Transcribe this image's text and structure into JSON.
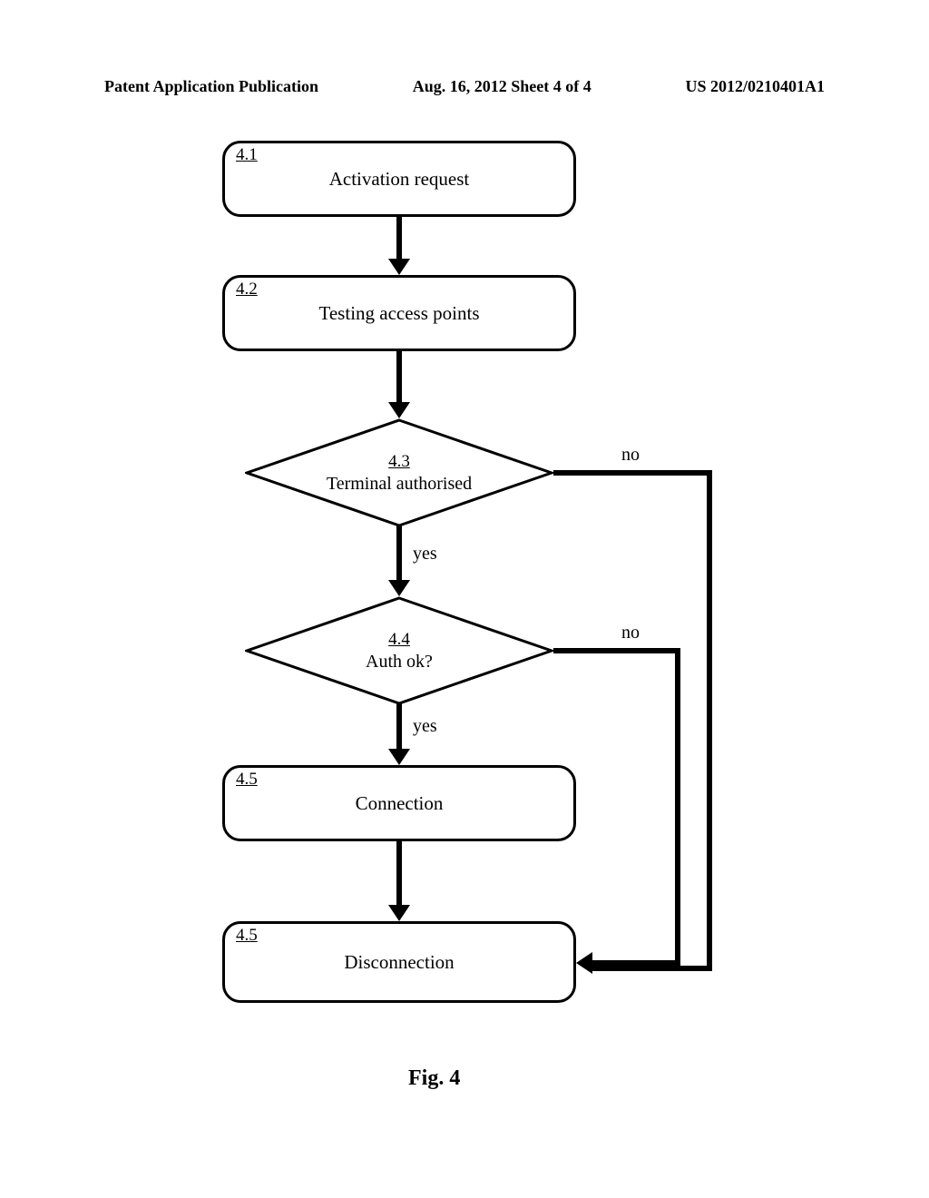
{
  "header": {
    "left": "Patent Application Publication",
    "center": "Aug. 16, 2012 Sheet 4 of 4",
    "right": "US 2012/0210401A1"
  },
  "flowchart": {
    "steps": {
      "s41": {
        "num": "4.1",
        "label": "Activation request"
      },
      "s42": {
        "num": "4.2",
        "label": "Testing access points"
      },
      "s43": {
        "num": "4.3",
        "label": "Terminal authorised"
      },
      "s44": {
        "num": "4.4",
        "label": "Auth ok?"
      },
      "s45": {
        "num": "4.5",
        "label": "Connection"
      },
      "s46": {
        "num": "4.5",
        "label": "Disconnection"
      }
    },
    "edges": {
      "yes43": "yes",
      "no43": "no",
      "yes44": "yes",
      "no44": "no"
    }
  },
  "caption": "Fig. 4"
}
